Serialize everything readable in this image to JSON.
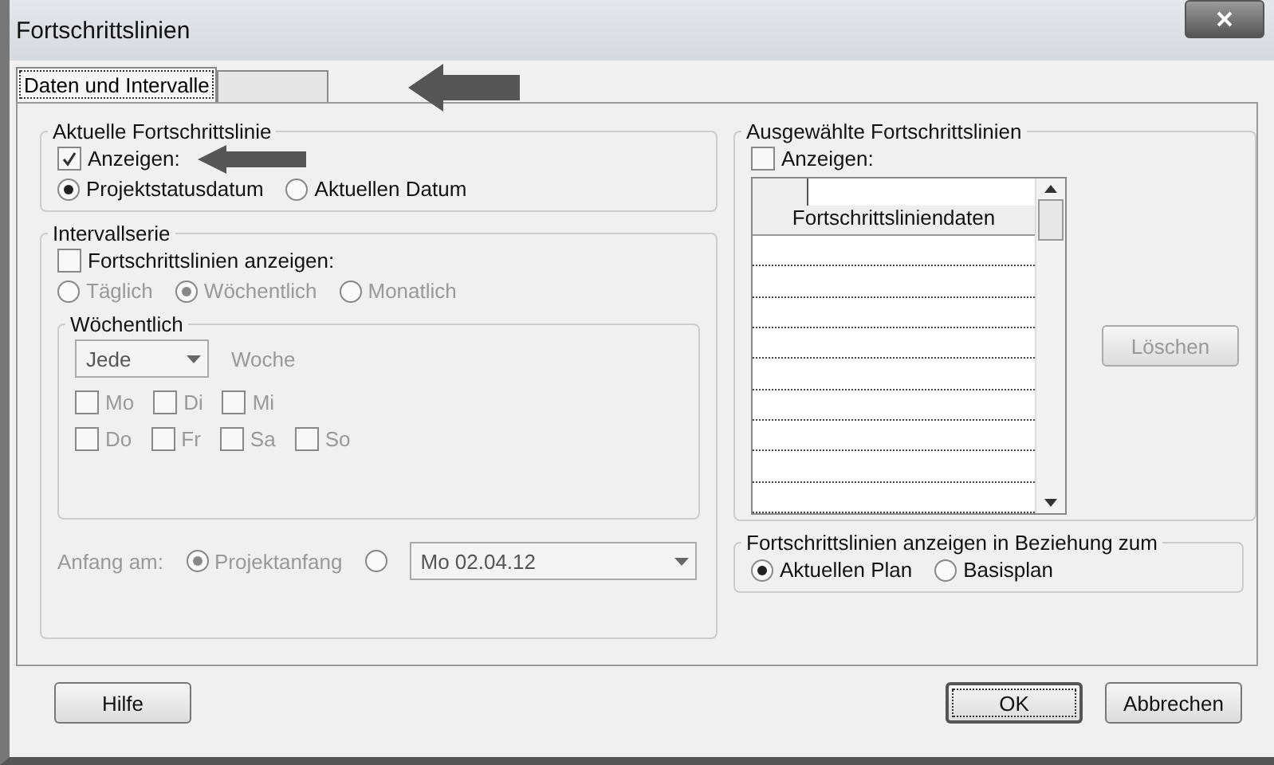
{
  "window": {
    "title": "Fortschrittslinien"
  },
  "tabs": [
    {
      "label": "Daten und Intervalle",
      "selected": true
    },
    {
      "selected": false
    }
  ],
  "current_line": {
    "title": "Aktuelle Fortschrittslinie",
    "show": {
      "label": "Anzeigen:",
      "checked": true
    },
    "options": [
      {
        "label": "Projektstatusdatum",
        "selected": true
      },
      {
        "label": "Aktuellen Datum",
        "selected": false
      }
    ]
  },
  "interval": {
    "title": "Intervallserie",
    "disabled": true,
    "show": {
      "label": "Fortschrittslinien anzeigen:",
      "checked": false
    },
    "frequency": [
      {
        "label": "Täglich",
        "selected": false
      },
      {
        "label": "Wöchentlich",
        "selected": true
      },
      {
        "label": "Monatlich",
        "selected": false
      }
    ],
    "weekly": {
      "title": "Wöchentlich",
      "every": {
        "value": "Jede"
      },
      "unit": "Woche",
      "days": [
        {
          "label": "Mo",
          "checked": false
        },
        {
          "label": "Di",
          "checked": false
        },
        {
          "label": "Mi",
          "checked": false
        },
        {
          "label": "Do",
          "checked": false
        },
        {
          "label": "Fr",
          "checked": false
        },
        {
          "label": "Sa",
          "checked": false
        },
        {
          "label": "So",
          "checked": false
        }
      ]
    },
    "start": {
      "label": "Anfang am:",
      "options": [
        {
          "label": "Projektanfang",
          "selected": true
        },
        {
          "selected": false
        }
      ],
      "date": {
        "value": "Mo 02.04.12"
      }
    }
  },
  "selected_lines": {
    "title": "Ausgewählte Fortschrittslinien",
    "show": {
      "label": "Anzeigen:",
      "checked": false
    },
    "table": {
      "columns": [
        "Fortschrittsliniendaten"
      ]
    },
    "delete_button": {
      "label": "Löschen",
      "disabled": true
    }
  },
  "relation": {
    "title": "Fortschrittslinien anzeigen in Beziehung zum",
    "options": [
      {
        "label": "Aktuellen Plan",
        "selected": true
      },
      {
        "label": "Basisplan",
        "selected": false
      }
    ]
  },
  "buttons": [
    {
      "label": "Hilfe",
      "default": false
    },
    {
      "label": "OK",
      "default": true
    },
    {
      "label": "Abbrechen",
      "default": false
    }
  ]
}
